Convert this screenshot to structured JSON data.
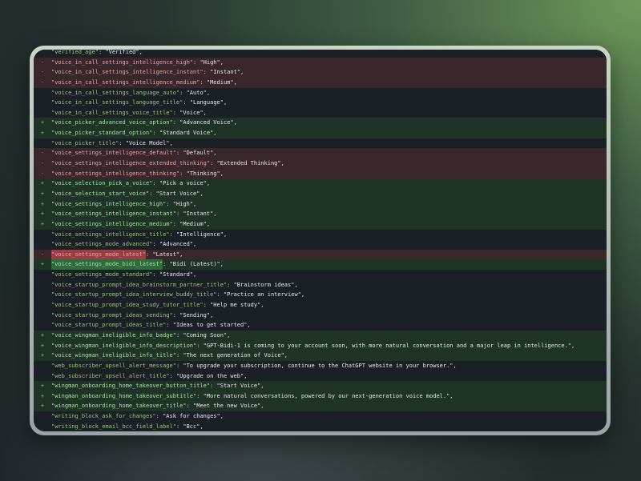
{
  "colors": {
    "deleted_bg": "#3a272b",
    "added_bg": "#1f3327",
    "context_bg": "#1b1f26",
    "key_color": "#98c379"
  },
  "diff": {
    "lines": [
      {
        "type": "ctx",
        "marker": "",
        "key": "\"verified_age\"",
        "value": "\"Verified\","
      },
      {
        "type": "del",
        "marker": "-",
        "key": "\"voice_in_call_settings_intelligence_high\"",
        "value": "\"High\","
      },
      {
        "type": "del",
        "marker": "-",
        "key": "\"voice_in_call_settings_intelligence_instant\"",
        "value": "\"Instant\","
      },
      {
        "type": "del",
        "marker": "-",
        "key": "\"voice_in_call_settings_intelligence_medium\"",
        "value": "\"Medium\","
      },
      {
        "type": "ctx",
        "marker": "",
        "key": "\"voice_in_call_settings_language_auto\"",
        "value": "\"Auto\","
      },
      {
        "type": "ctx",
        "marker": "",
        "key": "\"voice_in_call_settings_language_title\"",
        "value": "\"Language\","
      },
      {
        "type": "ctx",
        "marker": "",
        "key": "\"voice_in_call_settings_voice_title\"",
        "value": "\"Voice\","
      },
      {
        "type": "add",
        "marker": "+",
        "key": "\"voice_picker_advanced_voice_option\"",
        "value": "\"Advanced Voice\","
      },
      {
        "type": "add",
        "marker": "+",
        "key": "\"voice_picker_standard_option\"",
        "value": "\"Standard Voice\","
      },
      {
        "type": "ctx",
        "marker": "",
        "key": "\"voice_picker_title\"",
        "value": "\"Voice Model\","
      },
      {
        "type": "del",
        "marker": "-",
        "key": "\"voice_settings_intelligence_default\"",
        "value": "\"Default\","
      },
      {
        "type": "del",
        "marker": "-",
        "key": "\"voice_settings_intelligence_extended_thinking\"",
        "value": "\"Extended Thinking\","
      },
      {
        "type": "del",
        "marker": "-",
        "key": "\"voice_settings_intelligence_thinking\"",
        "value": "\"Thinking\","
      },
      {
        "type": "add",
        "marker": "+",
        "key": "\"voice_selection_pick_a_voice\"",
        "value": "\"Pick a voice\","
      },
      {
        "type": "add",
        "marker": "+",
        "key": "\"voice_selection_start_voice\"",
        "value": "\"Start Voice\","
      },
      {
        "type": "add",
        "marker": "+",
        "key": "\"voice_settings_intelligence_high\"",
        "value": "\"High\","
      },
      {
        "type": "add",
        "marker": "+",
        "key": "\"voice_settings_intelligence_instant\"",
        "value": "\"Instant\","
      },
      {
        "type": "add",
        "marker": "+",
        "key": "\"voice_settings_intelligence_medium\"",
        "value": "\"Medium\","
      },
      {
        "type": "ctx",
        "marker": "",
        "key": "\"voice_settings_intelligence_title\"",
        "value": "\"Intelligence\","
      },
      {
        "type": "ctx",
        "marker": "",
        "key": "\"voice_settings_mode_advanced\"",
        "value": "\"Advanced\","
      },
      {
        "type": "del",
        "marker": "-",
        "key": "\"voice_settings_mode_latest\"",
        "value": "\"Latest\",",
        "hl": "key"
      },
      {
        "type": "add",
        "marker": "+",
        "key": "\"voice_settings_mode_bidi_latest\"",
        "value": "\"Bidi (Latest)\",",
        "hl": "key"
      },
      {
        "type": "ctx",
        "marker": "",
        "key": "\"voice_settings_mode_standard\"",
        "value": "\"Standard\","
      },
      {
        "type": "ctx",
        "marker": "",
        "key": "\"voice_startup_prompt_idea_brainstorm_partner_title\"",
        "value": "\"Brainstorm ideas\","
      },
      {
        "type": "ctx",
        "marker": "",
        "key": "\"voice_startup_prompt_idea_interview_buddy_title\"",
        "value": "\"Practice an interview\","
      },
      {
        "type": "ctx",
        "marker": "",
        "key": "\"voice_startup_prompt_idea_study_tutor_title\"",
        "value": "\"Help me study\","
      },
      {
        "type": "ctx",
        "marker": "",
        "key": "\"voice_startup_prompt_ideas_sending\"",
        "value": "\"Sending\","
      },
      {
        "type": "ctx",
        "marker": "",
        "key": "\"voice_startup_prompt_ideas_title\"",
        "value": "\"Ideas to get started\","
      },
      {
        "type": "add",
        "marker": "+",
        "key": "\"voice_wingman_ineligible_info_badge\"",
        "value": "\"Coming Soon\","
      },
      {
        "type": "add",
        "marker": "+",
        "key": "\"voice_wingman_ineligible_info_description\"",
        "value": "\"GPT-Bidi-1 is coming to your account soon, with more natural conversation and a major leap in intelligence.\","
      },
      {
        "type": "add",
        "marker": "+",
        "key": "\"voice_wingman_ineligible_info_title\"",
        "value": "\"The next generation of Voice\","
      },
      {
        "type": "ctx",
        "marker": "",
        "key": "\"web_subscriber_upsell_alert_message\"",
        "value": "\"To upgrade your subscription, continue to the ChatGPT website in your browser.\","
      },
      {
        "type": "ctx",
        "marker": "",
        "key": "\"web_subscriber_upsell_alert_title\"",
        "value": "\"Upgrade on the web\","
      },
      {
        "type": "add",
        "marker": "+",
        "key": "\"wingman_onboarding_home_takeover_button_title\"",
        "value": "\"Start Voice\","
      },
      {
        "type": "add",
        "marker": "+",
        "key": "\"wingman_onboarding_home_takeover_subtitle\"",
        "value": "\"More natural conversations, powered by our next-generation voice model.\","
      },
      {
        "type": "add",
        "marker": "+",
        "key": "\"wingman_onboarding_home_takeover_title\"",
        "value": "\"Meet the new Voice\","
      },
      {
        "type": "ctx",
        "marker": "",
        "key": "\"writing_block_ask_for_changes\"",
        "value": "\"Ask for changes\","
      },
      {
        "type": "ctx",
        "marker": "",
        "key": "\"writing_block_email_bcc_field_label\"",
        "value": "\"Bcc\","
      }
    ]
  }
}
